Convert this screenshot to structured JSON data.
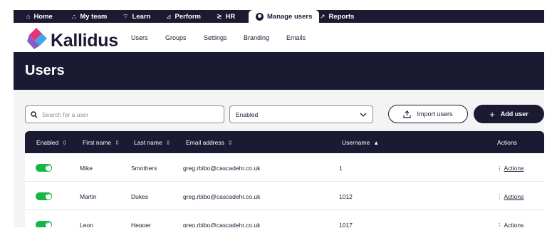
{
  "top_nav": {
    "items": [
      {
        "label": "Home",
        "icon": "home-icon"
      },
      {
        "label": "My team",
        "icon": "team-icon"
      },
      {
        "label": "Learn",
        "icon": "graduation-icon"
      },
      {
        "label": "Perform",
        "icon": "chart-icon"
      },
      {
        "label": "HR",
        "icon": "dna-icon"
      },
      {
        "label": "Manage users",
        "icon": "user-circle-icon",
        "active": true
      },
      {
        "label": "Reports",
        "icon": "trend-icon"
      }
    ]
  },
  "brand": {
    "name": "Kallidus",
    "colors": {
      "pink": "#e8347d",
      "blue": "#3ba9e8",
      "navy": "#1b1a33"
    }
  },
  "sub_nav": [
    "Users",
    "Groups",
    "Settings",
    "Branding",
    "Emails"
  ],
  "page": {
    "title": "Users"
  },
  "filters": {
    "search_placeholder": "Search for a user",
    "status_selected": "Enabled",
    "import_label": "Import users",
    "add_label": "Add user"
  },
  "table": {
    "headers": {
      "enabled": "Enabled",
      "first_name": "First name",
      "last_name": "Last name",
      "email": "Email address",
      "username": "Username",
      "actions": "Actions"
    },
    "rows": [
      {
        "enabled": true,
        "first_name": "Mike",
        "last_name": "Smothers",
        "email": "greg.rbibo@cascadehr.co.uk",
        "username": "1",
        "action": "Actions"
      },
      {
        "enabled": true,
        "first_name": "Martin",
        "last_name": "Dukes",
        "email": "greg.rbibo@cascadehr.co.uk",
        "username": "1012",
        "action": "Actions"
      },
      {
        "enabled": true,
        "first_name": "Leon",
        "last_name": "Hepper",
        "email": "greg.rbibo@cascadehr.co.uk",
        "username": "1017",
        "action": "Actions"
      }
    ]
  },
  "colors": {
    "toggle_on": "#19b446",
    "navy": "#1b1a33"
  }
}
